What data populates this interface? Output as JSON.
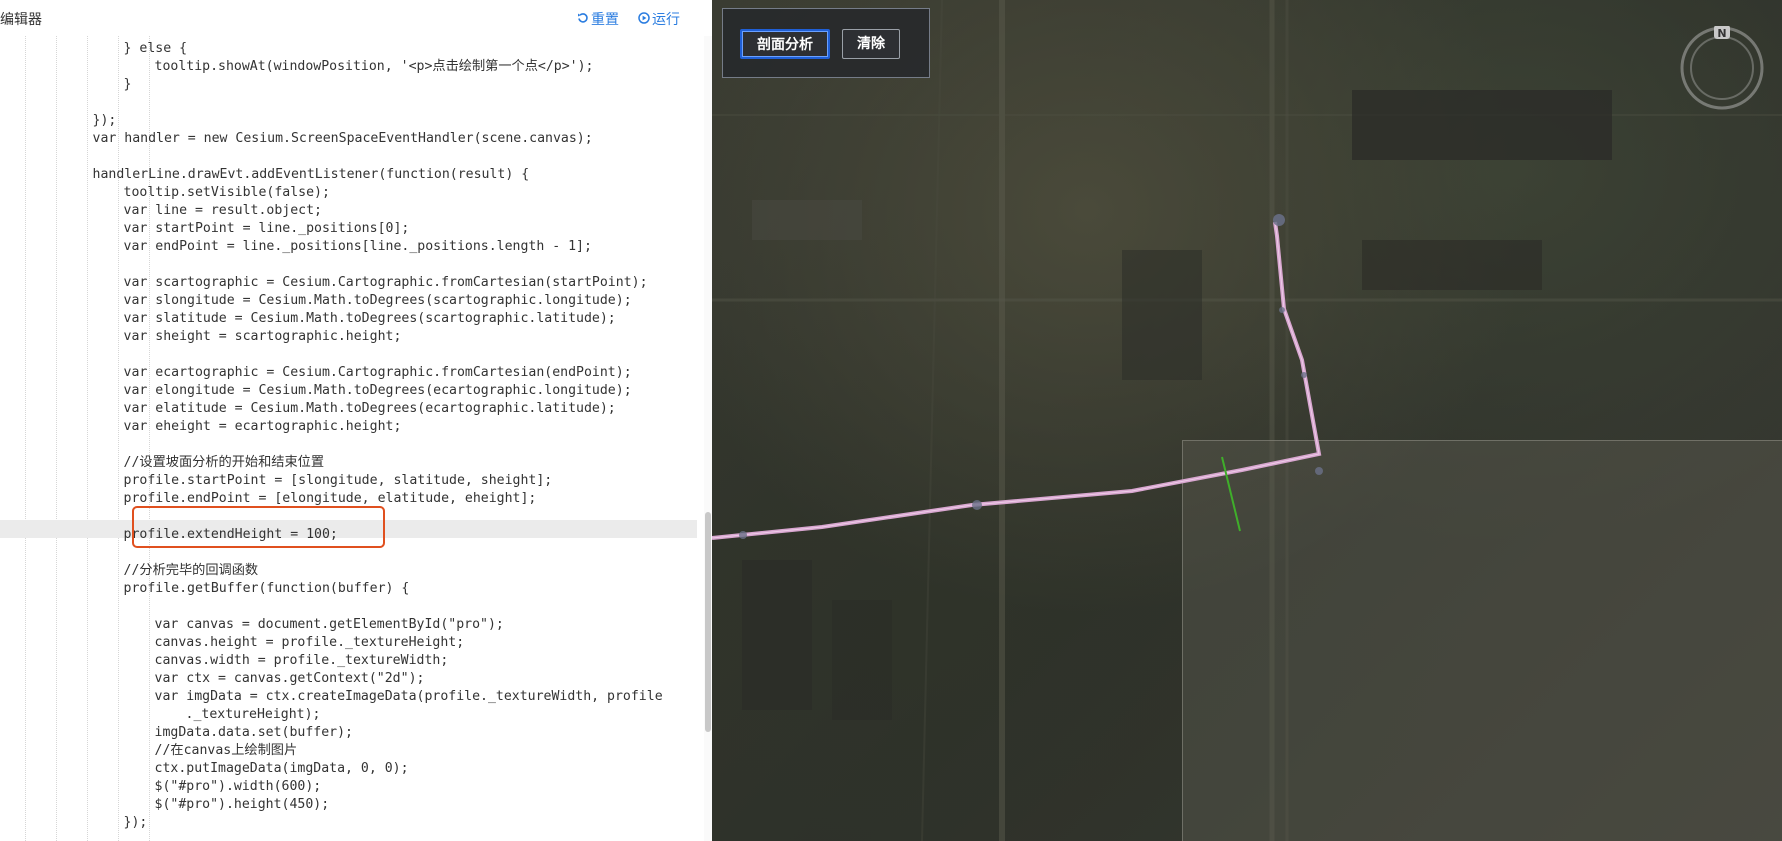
{
  "editor": {
    "title": "编辑器",
    "reset_label": "重置",
    "run_label": "运行",
    "active_line_index": 27,
    "code_lines": [
      {
        "indent": 4,
        "text": "} else {"
      },
      {
        "indent": 5,
        "text": "tooltip.showAt(windowPosition, '<p>点击绘制第一个点</p>');"
      },
      {
        "indent": 4,
        "text": "}"
      },
      {
        "indent": 0,
        "text": ""
      },
      {
        "indent": 3,
        "text": "});"
      },
      {
        "indent": 3,
        "text": "var handler = new Cesium.ScreenSpaceEventHandler(scene.canvas);"
      },
      {
        "indent": 0,
        "text": ""
      },
      {
        "indent": 3,
        "text": "handlerLine.drawEvt.addEventListener(function(result) {"
      },
      {
        "indent": 4,
        "text": "tooltip.setVisible(false);"
      },
      {
        "indent": 4,
        "text": "var line = result.object;"
      },
      {
        "indent": 4,
        "text": "var startPoint = line._positions[0];"
      },
      {
        "indent": 4,
        "text": "var endPoint = line._positions[line._positions.length - 1];"
      },
      {
        "indent": 0,
        "text": ""
      },
      {
        "indent": 4,
        "text": "var scartographic = Cesium.Cartographic.fromCartesian(startPoint);"
      },
      {
        "indent": 4,
        "text": "var slongitude = Cesium.Math.toDegrees(scartographic.longitude);"
      },
      {
        "indent": 4,
        "text": "var slatitude = Cesium.Math.toDegrees(scartographic.latitude);"
      },
      {
        "indent": 4,
        "text": "var sheight = scartographic.height;"
      },
      {
        "indent": 0,
        "text": ""
      },
      {
        "indent": 4,
        "text": "var ecartographic = Cesium.Cartographic.fromCartesian(endPoint);"
      },
      {
        "indent": 4,
        "text": "var elongitude = Cesium.Math.toDegrees(ecartographic.longitude);"
      },
      {
        "indent": 4,
        "text": "var elatitude = Cesium.Math.toDegrees(ecartographic.latitude);"
      },
      {
        "indent": 4,
        "text": "var eheight = ecartographic.height;"
      },
      {
        "indent": 0,
        "text": ""
      },
      {
        "indent": 4,
        "text": "//设置坡面分析的开始和结束位置"
      },
      {
        "indent": 4,
        "text": "profile.startPoint = [slongitude, slatitude, sheight];"
      },
      {
        "indent": 4,
        "text": "profile.endPoint = [elongitude, elatitude, eheight];"
      },
      {
        "indent": 0,
        "text": ""
      },
      {
        "indent": 4,
        "text": "profile.extendHeight = 100;"
      },
      {
        "indent": 0,
        "text": ""
      },
      {
        "indent": 4,
        "text": "//分析完毕的回调函数"
      },
      {
        "indent": 4,
        "text": "profile.getBuffer(function(buffer) {"
      },
      {
        "indent": 0,
        "text": ""
      },
      {
        "indent": 5,
        "text": "var canvas = document.getElementById(\"pro\");"
      },
      {
        "indent": 5,
        "text": "canvas.height = profile._textureHeight;"
      },
      {
        "indent": 5,
        "text": "canvas.width = profile._textureWidth;"
      },
      {
        "indent": 5,
        "text": "var ctx = canvas.getContext(\"2d\");"
      },
      {
        "indent": 5,
        "text": "var imgData = ctx.createImageData(profile._textureWidth, profile"
      },
      {
        "indent": 6,
        "text": "._textureHeight);"
      },
      {
        "indent": 5,
        "text": "imgData.data.set(buffer);"
      },
      {
        "indent": 5,
        "text": "//在canvas上绘制图片"
      },
      {
        "indent": 5,
        "text": "ctx.putImageData(imgData, 0, 0);"
      },
      {
        "indent": 5,
        "text": "$(\"#pro\").width(600);"
      },
      {
        "indent": 5,
        "text": "$(\"#pro\").height(450);"
      },
      {
        "indent": 4,
        "text": "});"
      }
    ]
  },
  "map": {
    "profile_button_label": "剖面分析",
    "clear_button_label": "清除",
    "compass_north_label": "N"
  },
  "colors": {
    "accent": "#2b7de0",
    "highlight_border": "#e0501f",
    "profile_line": "#d8a6d0",
    "profile_marker": "#3fae2a",
    "button_focus": "#1f5fd6"
  }
}
